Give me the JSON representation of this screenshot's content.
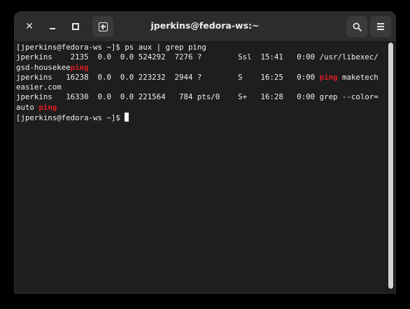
{
  "window": {
    "title": "jperkins@fedora-ws:~"
  },
  "headerbar": {
    "close_icon": "close-icon",
    "minimize_icon": "minimize-icon",
    "maximize_icon": "maximize-icon",
    "new_tab_icon": "new-tab-icon",
    "search_icon": "search-icon",
    "menu_icon": "hamburger-menu-icon"
  },
  "terminal": {
    "lines": [
      [
        {
          "t": "[jperkins@fedora-ws ~]$ ps aux | grep ping"
        }
      ],
      [
        {
          "t": "jperkins    2135  0.0  0.0 524292  7276 ?        Ssl  15:41   0:00 /usr/libexec/"
        }
      ],
      [
        {
          "t": "gsd-housekee"
        },
        {
          "t": "ping",
          "hl": true
        }
      ],
      [
        {
          "t": "jperkins   16238  0.0  0.0 223232  2944 ?        S    16:25   0:00 "
        },
        {
          "t": "ping",
          "hl": true
        },
        {
          "t": " maketech"
        }
      ],
      [
        {
          "t": "easier.com"
        }
      ],
      [
        {
          "t": "jperkins   16330  0.0  0.0 221564   784 pts/0    S+   16:28   0:00 grep --color="
        }
      ],
      [
        {
          "t": "auto "
        },
        {
          "t": "ping",
          "hl": true
        }
      ],
      [
        {
          "t": "[jperkins@fedora-ws ~]$ "
        }
      ]
    ],
    "highlight_color": "#e01b24",
    "text_color": "#f0f0f0",
    "background_color": "#1e1e1e"
  }
}
